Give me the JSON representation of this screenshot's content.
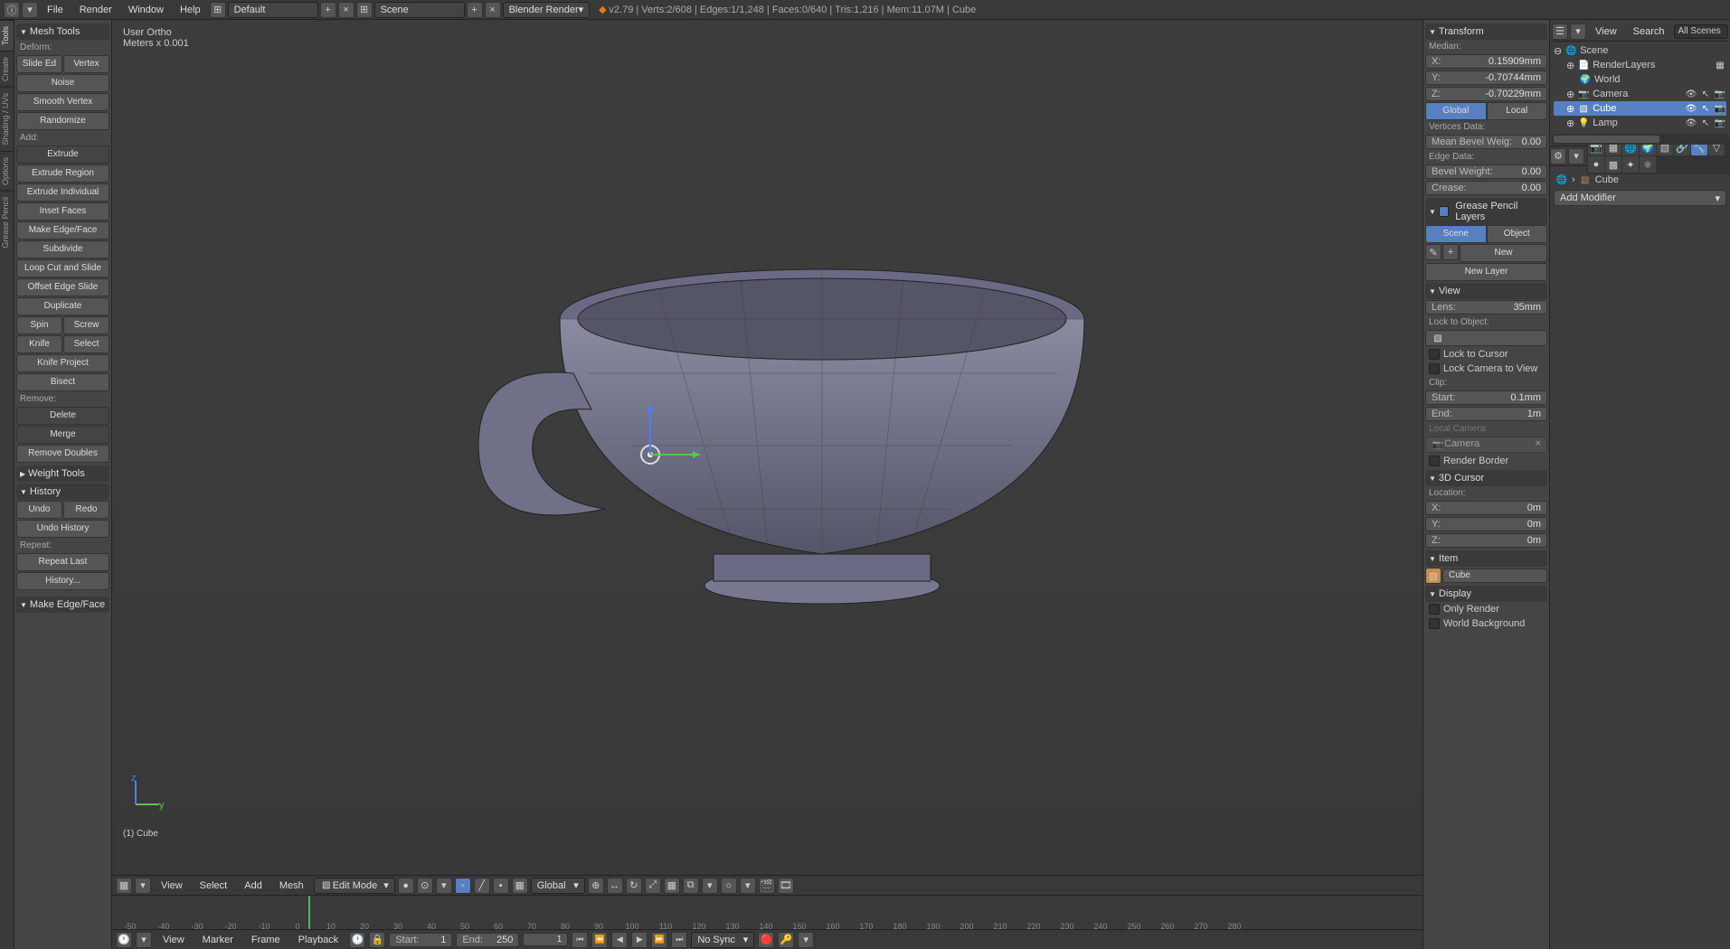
{
  "topbar": {
    "menus": [
      "File",
      "Render",
      "Window",
      "Help"
    ],
    "layout_field": "Default",
    "scene_field": "Scene",
    "engine": "Blender Render",
    "stats": "v2.79 | Verts:2/608 | Edges:1/1,248 | Faces:0/640 | Tris:1,216 | Mem:11.07M | Cube"
  },
  "lefttabs": [
    "Tools",
    "Create",
    "Shading / UVs",
    "Options",
    "Grease Pencil"
  ],
  "toolpanel": {
    "mesh_tools_header": "Mesh Tools",
    "deform_label": "Deform:",
    "slide_edge": "Slide Ed",
    "vertex": "Vertex",
    "noise": "Noise",
    "smooth_vertex": "Smooth Vertex",
    "randomize": "Randomize",
    "add_label": "Add:",
    "extrude": "Extrude",
    "extrude_region": "Extrude Region",
    "extrude_individual": "Extrude Individual",
    "inset_faces": "Inset Faces",
    "make_edge_face": "Make Edge/Face",
    "subdivide": "Subdivide",
    "loop_cut": "Loop Cut and Slide",
    "offset_edge": "Offset Edge Slide",
    "duplicate": "Duplicate",
    "spin": "Spin",
    "screw": "Screw",
    "knife": "Knife",
    "select": "Select",
    "knife_project": "Knife Project",
    "bisect": "Bisect",
    "remove_label": "Remove:",
    "delete": "Delete",
    "merge": "Merge",
    "remove_doubles": "Remove Doubles",
    "weight_tools_header": "Weight Tools",
    "history_header": "History",
    "undo": "Undo",
    "redo": "Redo",
    "undo_history": "Undo History",
    "repeat_label": "Repeat:",
    "repeat_last": "Repeat Last",
    "history_dots": "History...",
    "last_op_header": "Make Edge/Face"
  },
  "viewport": {
    "ortho_label": "User Ortho",
    "units_label": "Meters x 0.001",
    "object_label": "(1) Cube"
  },
  "view_header": {
    "menus": [
      "View",
      "Select",
      "Add",
      "Mesh"
    ],
    "mode": "Edit Mode",
    "orientation": "Global"
  },
  "timeline": {
    "menus": [
      "View",
      "Marker",
      "Frame",
      "Playback"
    ],
    "start_label": "Start:",
    "start_val": "1",
    "end_label": "End:",
    "end_val": "250",
    "current": "1",
    "sync": "No Sync",
    "ticks": [
      "-50",
      "-40",
      "-30",
      "-20",
      "-10",
      "0",
      "10",
      "20",
      "30",
      "40",
      "50",
      "60",
      "70",
      "80",
      "90",
      "100",
      "110",
      "120",
      "130",
      "140",
      "150",
      "160",
      "170",
      "180",
      "190",
      "200",
      "210",
      "220",
      "230",
      "240",
      "250",
      "260",
      "270",
      "280"
    ]
  },
  "rpanel": {
    "transform_header": "Transform",
    "median_label": "Median:",
    "x_label": "X:",
    "x_val": "0.15909mm",
    "y_label": "Y:",
    "y_val": "-0.70744mm",
    "z_label": "Z:",
    "z_val": "-0.70229mm",
    "global": "Global",
    "local": "Local",
    "vertices_data": "Vertices Data:",
    "mean_bevel": "Mean Bevel Weig:",
    "mean_bevel_val": "0.00",
    "edge_data": "Edge Data:",
    "bevel_weight": "Bevel Weight:",
    "bevel_weight_val": "0.00",
    "crease": "Crease:",
    "crease_val": "0.00",
    "gp_header": "Grease Pencil Layers",
    "scene_btn": "Scene",
    "object_btn": "Object",
    "new": "New",
    "new_layer": "New Layer",
    "view_header": "View",
    "lens_label": "Lens:",
    "lens_val": "35mm",
    "lock_to_object": "Lock to Object:",
    "lock_cursor": "Lock to Cursor",
    "lock_camera": "Lock Camera to View",
    "clip_label": "Clip:",
    "clip_start": "Start:",
    "clip_start_val": "0.1mm",
    "clip_end": "End:",
    "clip_end_val": "1m",
    "local_camera": "Local Camera:",
    "camera_val": "Camera",
    "render_border": "Render Border",
    "cursor_header": "3D Cursor",
    "location_label": "Location:",
    "cx": "X:",
    "cx_val": "0m",
    "cy": "Y:",
    "cy_val": "0m",
    "cz": "Z:",
    "cz_val": "0m",
    "item_header": "Item",
    "item_name": "Cube",
    "display_header": "Display",
    "only_render": "Only Render",
    "world_bg": "World Background"
  },
  "outliner": {
    "view_btn": "View",
    "search_btn": "Search",
    "all_scenes": "All Scenes",
    "scene": "Scene",
    "render_layers": "RenderLayers",
    "world": "World",
    "camera": "Camera",
    "cube": "Cube",
    "lamp": "Lamp"
  },
  "properties": {
    "breadcrumb_obj": "Cube",
    "add_modifier": "Add Modifier"
  }
}
